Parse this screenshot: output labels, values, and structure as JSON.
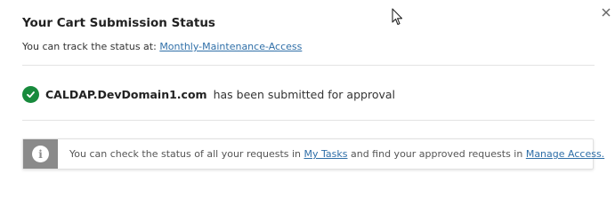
{
  "dialog": {
    "title": "Your Cart Submission Status",
    "close_icon": "close-icon",
    "track_prefix": "You can track the status at:",
    "track_link": "Monthly-Maintenance-Access"
  },
  "status": {
    "icon": "check-circle-icon",
    "item_name": "CALDAP.DevDomain1.com",
    "message": "has been submitted for approval",
    "color": "#178a3c"
  },
  "info": {
    "icon": "info-icon",
    "text_before": "You can check the status of all your requests in",
    "my_tasks_link": "My Tasks",
    "text_middle": "and find your approved requests in",
    "manage_access_link": "Manage Access."
  },
  "colors": {
    "link": "#2f6fa8",
    "info_strip": "#8a8a8a"
  }
}
